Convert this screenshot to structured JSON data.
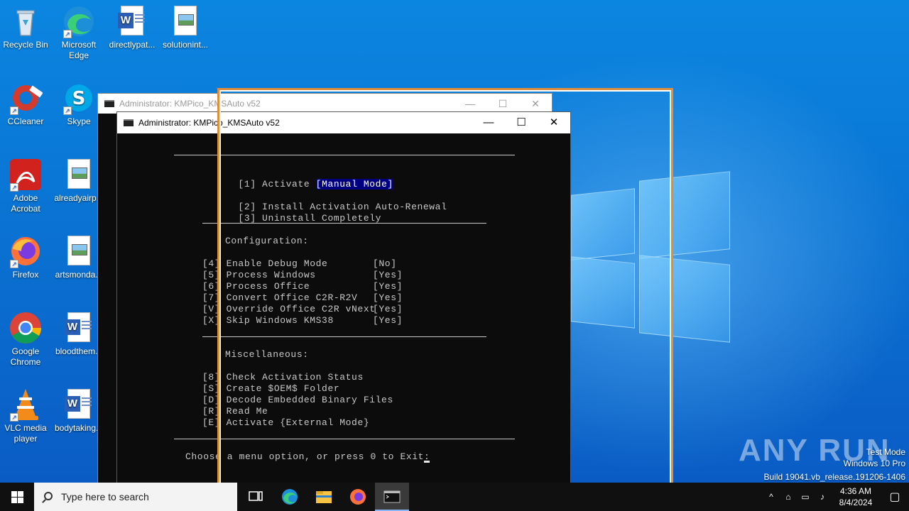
{
  "desktop": {
    "icons": [
      {
        "label": "Recycle Bin",
        "icon": "recycle-bin-icon"
      },
      {
        "label": "Microsoft Edge",
        "icon": "edge-icon"
      },
      {
        "label": "directlypat...",
        "icon": "word-doc-icon"
      },
      {
        "label": "solutionint...",
        "icon": "image-file-icon"
      },
      {
        "label": "CCleaner",
        "icon": "ccleaner-icon"
      },
      {
        "label": "Skype",
        "icon": "skype-icon"
      },
      {
        "label": "Adobe Acrobat",
        "icon": "acrobat-icon"
      },
      {
        "label": "alreadyairp...",
        "icon": "image-file-icon"
      },
      {
        "label": "Firefox",
        "icon": "firefox-icon"
      },
      {
        "label": "artsmonda...",
        "icon": "image-file-icon"
      },
      {
        "label": "Google Chrome",
        "icon": "chrome-icon"
      },
      {
        "label": "bloodthem...",
        "icon": "word-doc-icon"
      },
      {
        "label": "VLC media player",
        "icon": "vlc-icon"
      },
      {
        "label": "bodytaking...",
        "icon": "word-doc-icon"
      }
    ]
  },
  "back_window": {
    "title": "Administrator:  KMPico_KMSAuto v52",
    "minimize": "—",
    "maximize": "☐",
    "close": "✕",
    "prompt_char": ">"
  },
  "front_window": {
    "title": "Administrator:  KMPico_KMSAuto v52",
    "minimize": "—",
    "maximize": "☐",
    "close": "✕"
  },
  "console": {
    "activate_key": "[1]",
    "activate_label": "Activate ",
    "activate_mode": "[Manual Mode]",
    "main_options": [
      {
        "key": "[2]",
        "label": "Install Activation Auto-Renewal"
      },
      {
        "key": "[3]",
        "label": "Uninstall Completely"
      }
    ],
    "configuration_heading": "Configuration:",
    "config_options": [
      {
        "key": "[4]",
        "label": "Enable Debug Mode",
        "value": "[No]"
      },
      {
        "key": "[5]",
        "label": "Process Windows",
        "value": "[Yes]"
      },
      {
        "key": "[6]",
        "label": "Process Office",
        "value": "[Yes]"
      },
      {
        "key": "[7]",
        "label": "Convert Office C2R-R2V",
        "value": "[Yes]"
      },
      {
        "key": "[V]",
        "label": "Override Office C2R vNext",
        "value": "[Yes]"
      },
      {
        "key": "[X]",
        "label": "Skip Windows KMS38",
        "value": "[Yes]"
      }
    ],
    "misc_heading": "Miscellaneous:",
    "misc_options": [
      {
        "key": "[8]",
        "label": "Check Activation Status"
      },
      {
        "key": "[S]",
        "label": "Create $OEM$ Folder"
      },
      {
        "key": "[D]",
        "label": "Decode Embedded Binary Files"
      },
      {
        "key": "[R]",
        "label": "Read Me"
      },
      {
        "key": "[E]",
        "label": "Activate {External Mode}"
      }
    ],
    "prompt": "Choose a menu option, or press 0 to Exit: "
  },
  "taskbar": {
    "search_placeholder": "Type here to search",
    "apps": [
      "task-view-icon",
      "edge-icon",
      "file-explorer-icon",
      "firefox-icon",
      "cmd-icon"
    ],
    "time": "4:36 AM",
    "date": "8/4/2024"
  },
  "watermark": {
    "brand": "ANY RUN",
    "line1": "Test Mode",
    "line2": "Windows 10 Pro",
    "line3": "Build 19041.vb_release.191206-1406"
  },
  "colors": {
    "highlight_frame": "#e08e3c",
    "console_bg": "#0c0c0c",
    "console_fg": "#c8c8c8",
    "selection_bg": "#000080"
  }
}
